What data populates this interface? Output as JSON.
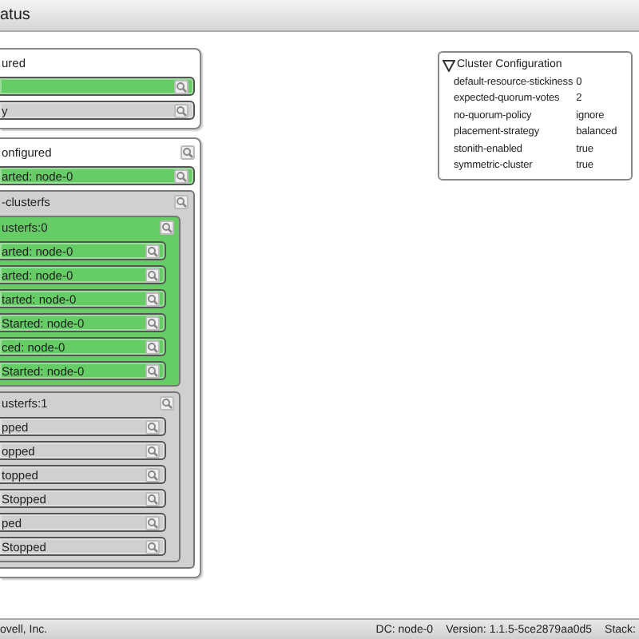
{
  "window": {
    "title": "atus"
  },
  "sections": [
    {
      "title": "ured",
      "items": [
        {
          "kind": "resource",
          "running": true
        },
        {
          "kind": "resource",
          "label": "y",
          "running": false
        }
      ]
    },
    {
      "title": "onfigured",
      "items": [
        {
          "kind": "resource",
          "label": "arted: node-0",
          "running": true
        },
        {
          "kind": "group",
          "label": "-clusterfs",
          "running": false,
          "children": [
            {
              "kind": "group",
              "label": "usterfs:0",
              "running": true,
              "children": [
                {
                  "kind": "resource",
                  "label": "arted: node-0",
                  "running": true
                },
                {
                  "kind": "resource",
                  "label": "arted: node-0",
                  "running": true
                },
                {
                  "kind": "resource",
                  "label": "tarted: node-0",
                  "running": true
                },
                {
                  "kind": "resource",
                  "label": "Started: node-0",
                  "running": true
                },
                {
                  "kind": "resource",
                  "label": "ced: node-0",
                  "running": true
                },
                {
                  "kind": "resource",
                  "label": "Started: node-0",
                  "running": true
                }
              ]
            },
            {
              "kind": "group",
              "label": "usterfs:1",
              "running": false,
              "children": [
                {
                  "kind": "resource",
                  "label": "pped",
                  "running": false
                },
                {
                  "kind": "resource",
                  "label": "opped",
                  "running": false
                },
                {
                  "kind": "resource",
                  "label": "topped",
                  "running": false
                },
                {
                  "kind": "resource",
                  "label": "Stopped",
                  "running": false
                },
                {
                  "kind": "resource",
                  "label": "ped",
                  "running": false
                },
                {
                  "kind": "resource",
                  "label": "Stopped",
                  "running": false
                }
              ]
            }
          ]
        }
      ]
    }
  ],
  "cluster_configuration": {
    "title": "Cluster Configuration",
    "expanded": true,
    "rows": [
      {
        "name": "default-resource-stickiness",
        "value": "0"
      },
      {
        "name": "expected-quorum-votes",
        "value": "2"
      },
      {
        "name": "no-quorum-policy",
        "value": "ignore"
      },
      {
        "name": "placement-strategy",
        "value": "balanced"
      },
      {
        "name": "stonith-enabled",
        "value": "true"
      },
      {
        "name": "symmetric-cluster",
        "value": "true"
      }
    ]
  },
  "status_bar": {
    "vendor": "ovell, Inc.",
    "dc": "DC: node-0",
    "version": "Version: 1.1.5-5ce2879aa0d5",
    "stack": "Stack:"
  }
}
